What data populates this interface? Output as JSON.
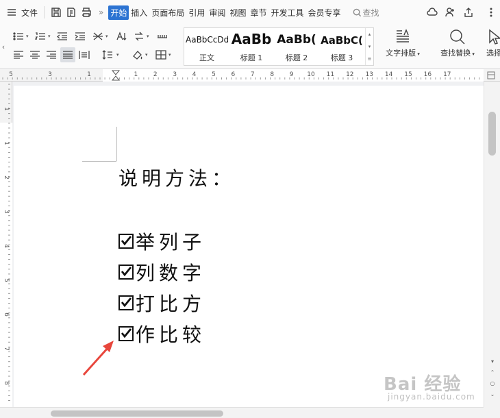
{
  "menubar": {
    "file_label": "文件",
    "tabs": [
      {
        "label": "开始",
        "active": true
      },
      {
        "label": "插入"
      },
      {
        "label": "页面布局"
      },
      {
        "label": "引用"
      },
      {
        "label": "审阅"
      },
      {
        "label": "视图"
      },
      {
        "label": "章节"
      },
      {
        "label": "开发工具"
      },
      {
        "label": "会员专享"
      }
    ],
    "search_label": "查找",
    "more_symbol": "»"
  },
  "ribbon": {
    "styles": [
      {
        "sample": "AaBbCcDd",
        "name": "正文"
      },
      {
        "sample": "AaBb",
        "name": "标题 1"
      },
      {
        "sample": "AaBb(",
        "name": "标题 2"
      },
      {
        "sample": "AaBbC(",
        "name": "标题 3"
      }
    ],
    "text_layout_label": "文字排版",
    "find_replace_label": "查找替换",
    "select_label": "选择"
  },
  "ruler": {
    "h_labels": [
      "5",
      "3",
      "1",
      "1",
      "2",
      "3",
      "4",
      "5",
      "6",
      "7",
      "8",
      "9",
      "10",
      "11",
      "12",
      "13",
      "14",
      "15",
      "16",
      "17"
    ],
    "v_labels": [
      "1",
      "1",
      "2",
      "3",
      "4",
      "5",
      "6",
      "7",
      "8"
    ]
  },
  "document": {
    "heading": "说明方法：",
    "checklist": [
      {
        "text": "举列子",
        "checked": true
      },
      {
        "text": "列数字",
        "checked": true
      },
      {
        "text": "打比方",
        "checked": true
      },
      {
        "text": "作比较",
        "checked": true
      }
    ]
  },
  "watermark": {
    "brand": "Bai 经验",
    "url": "jingyan.baidu.com"
  },
  "colors": {
    "accent": "#2c73d2",
    "annotation_arrow": "#e8463c",
    "text": "#111111"
  }
}
